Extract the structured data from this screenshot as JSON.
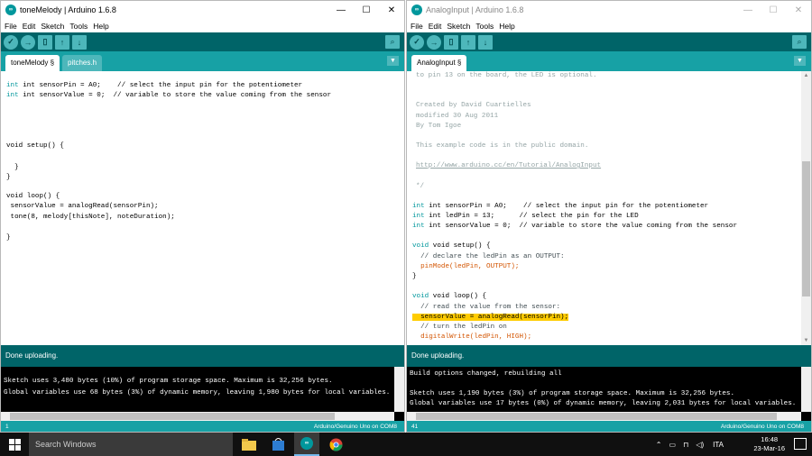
{
  "left_window": {
    "title": "toneMelody | Arduino 1.6.8",
    "menu": [
      "File",
      "Edit",
      "Sketch",
      "Tools",
      "Help"
    ],
    "tabs": [
      "toneMelody §",
      "pitches.h"
    ],
    "lines": [
      "int sensorPin = A0;    // select the input pin for the potentiometer",
      "int sensorValue = 0;  // variable to store the value coming from the sensor",
      "void setup() {",
      "  }",
      "}",
      "void loop() {",
      " sensorValue = analogRead(sensorPin);",
      " tone(8, melody[thisNote], noteDuration);",
      "}"
    ],
    "status": "Done uploading.",
    "console": [
      "Sketch uses 3,480 bytes (10%) of program storage space. Maximum is 32,256 bytes.",
      "Global variables use 68 bytes (3%) of dynamic memory, leaving 1,980 bytes for local variables."
    ],
    "footer_line": "1",
    "footer_board": "Arduino/Genuino Uno on COM8"
  },
  "right_window": {
    "title": "AnalogInput | Arduino 1.6.8",
    "menu": [
      "File",
      "Edit",
      "Sketch",
      "Tools",
      "Help"
    ],
    "tabs": [
      "AnalogInput §"
    ],
    "lines": [
      "to pin 13 on the board, the LED is optional.",
      "Created by David Cuartielles",
      "modified 30 Aug 2011",
      "By Tom Igoe",
      "This example code is in the public domain.",
      "http://www.arduino.cc/en/Tutorial/AnalogInput",
      "*/",
      "int sensorPin = A0;    // select the input pin for the potentiometer",
      "int ledPin = 13;      // select the pin for the LED",
      "int sensorValue = 0;  // variable to store the value coming from the sensor",
      "void setup() {",
      "  // declare the ledPin as an OUTPUT:",
      "  pinMode(ledPin, OUTPUT);",
      "}",
      "void loop() {",
      "  // read the value from the sensor:",
      "  sensorValue = analogRead(sensorPin);",
      "  // turn the ledPin on",
      "  digitalWrite(ledPin, HIGH);"
    ],
    "status": "Done uploading.",
    "console": [
      "Build options changed, rebuilding all",
      "Sketch uses 1,190 bytes (3%) of program storage space. Maximum is 32,256 bytes.",
      "Global variables use 17 bytes (0%) of dynamic memory, leaving 2,031 bytes for local variables."
    ],
    "footer_line": "41",
    "footer_board": "Arduino/Genuino Uno on COM8"
  },
  "taskbar": {
    "search_placeholder": "Search Windows",
    "language": "ITA",
    "time": "16:48",
    "date": "23-Mar-16"
  },
  "colors": {
    "toolbar": "#006468",
    "tabstrip": "#17a1a5",
    "button": "#4db7bb",
    "keyword": "#00979c",
    "function": "#d35400",
    "highlight": "#ffcc00"
  }
}
